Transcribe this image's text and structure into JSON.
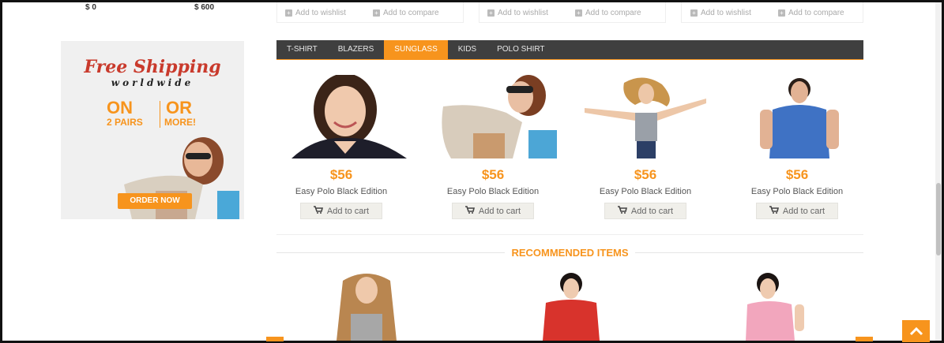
{
  "price_range": {
    "min": "$ 0",
    "max": "$ 600"
  },
  "product_actions": {
    "wishlist": "Add to wishlist",
    "compare": "Add to compare"
  },
  "ad_banner": {
    "title": "Free Shipping",
    "subtitle": "worldwide",
    "offer_left_big": "ON",
    "offer_right_big": "OR",
    "offer_left_small": "2 PAIRS",
    "offer_right_small": "MORE!",
    "cta": "ORDER NOW"
  },
  "tabs": [
    {
      "label": "T-SHIRT",
      "active": false
    },
    {
      "label": "BLAZERS",
      "active": false
    },
    {
      "label": "SUNGLASS",
      "active": true
    },
    {
      "label": "KIDS",
      "active": false
    },
    {
      "label": "POLO SHIRT",
      "active": false
    }
  ],
  "products": [
    {
      "price": "$56",
      "name": "Easy Polo Black Edition",
      "cart_label": "Add to cart"
    },
    {
      "price": "$56",
      "name": "Easy Polo Black Edition",
      "cart_label": "Add to cart"
    },
    {
      "price": "$56",
      "name": "Easy Polo Black Edition",
      "cart_label": "Add to cart"
    },
    {
      "price": "$56",
      "name": "Easy Polo Black Edition",
      "cart_label": "Add to cart"
    }
  ],
  "recommended": {
    "title": "RECOMMENDED ITEMS"
  },
  "colors": {
    "accent": "#f7941d",
    "tabbar": "#3f3f3f",
    "ad_red": "#c93a2c"
  }
}
